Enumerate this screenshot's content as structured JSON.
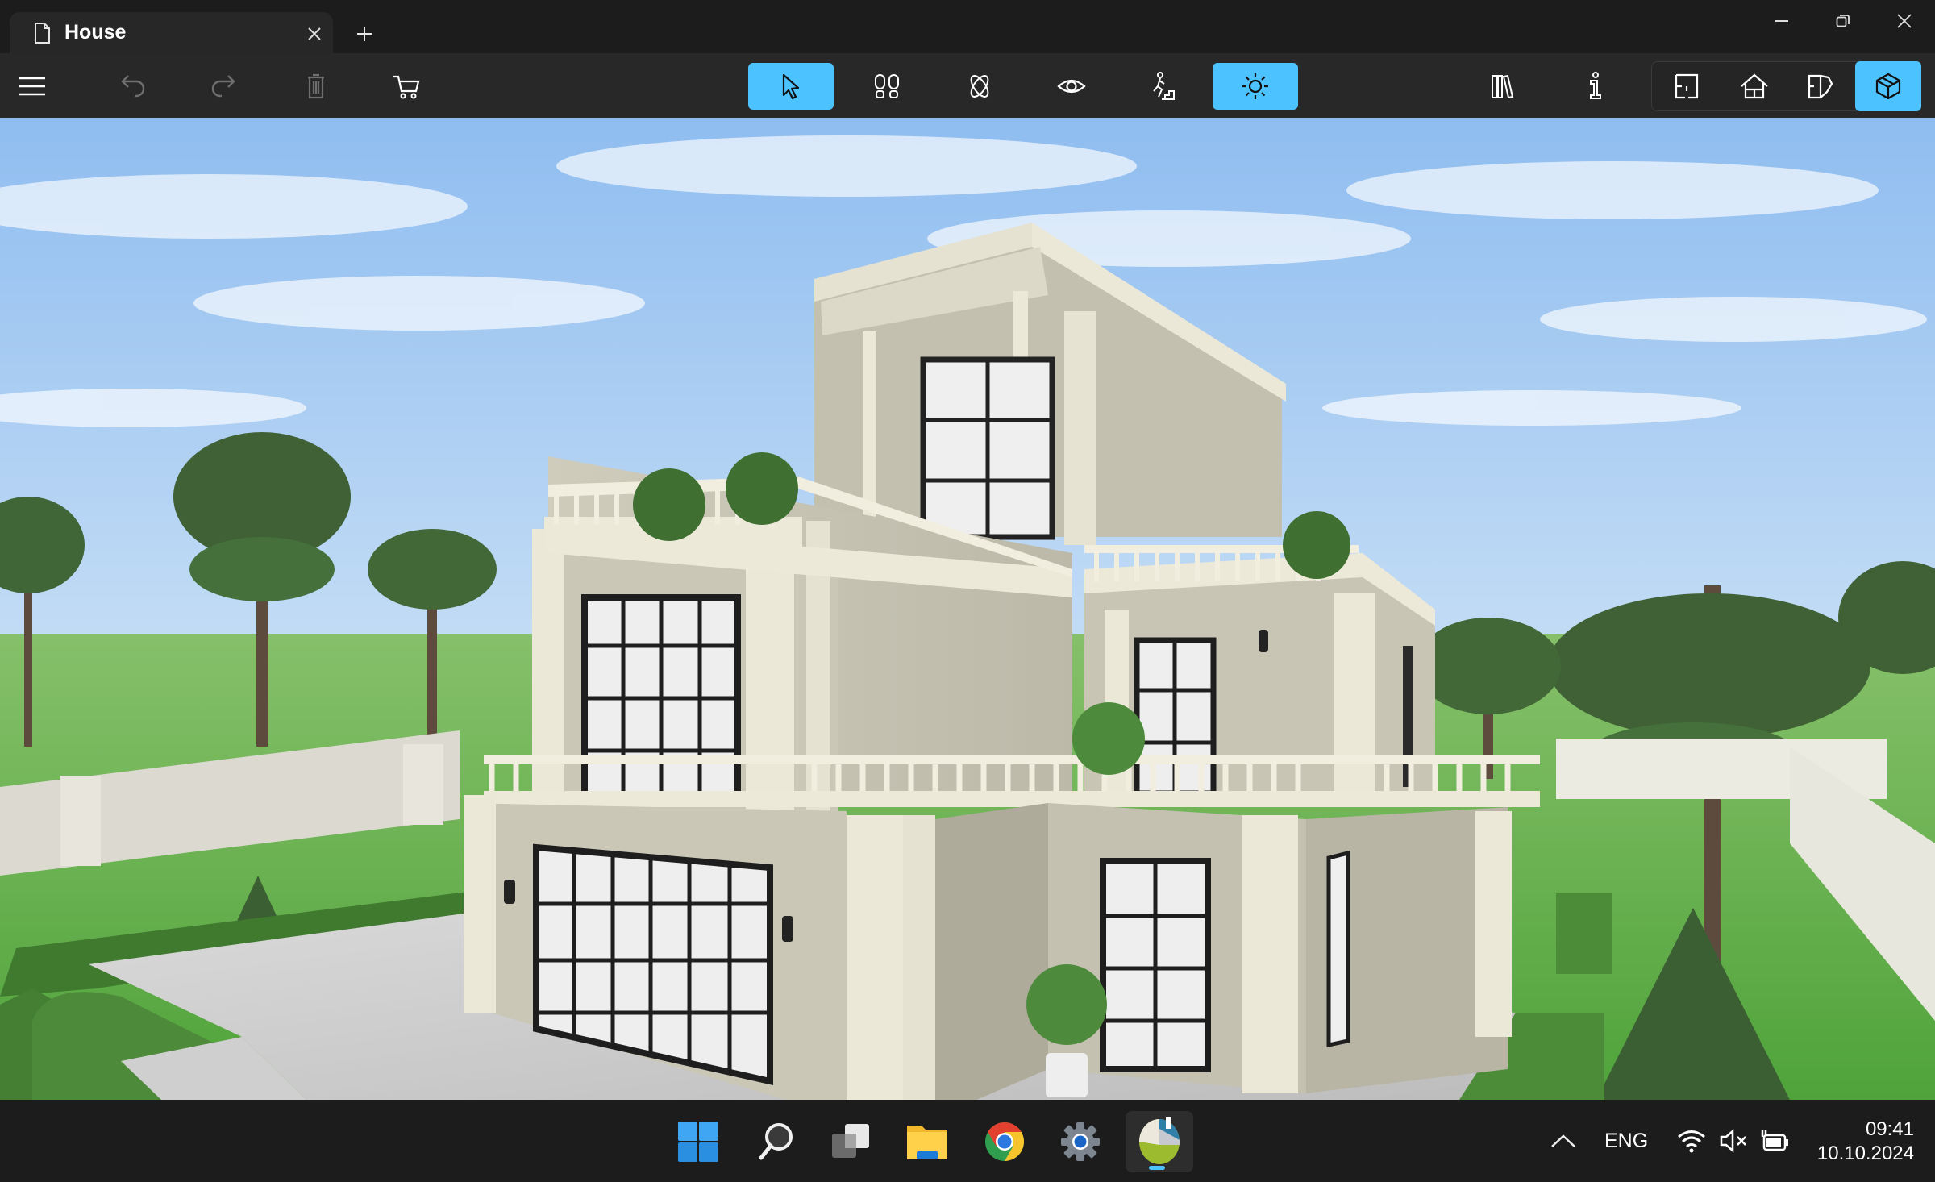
{
  "window": {
    "tab_title": "House",
    "tab_icon": "document-icon",
    "close_tab_icon": "close-icon",
    "new_tab_icon": "plus-icon",
    "controls": [
      "minimize-icon",
      "restore-icon",
      "close-icon"
    ]
  },
  "toolbar": {
    "left": [
      {
        "name": "menu",
        "icon": "hamburger-icon",
        "enabled": true
      },
      {
        "name": "undo",
        "icon": "undo-icon",
        "enabled": false
      },
      {
        "name": "redo",
        "icon": "redo-icon",
        "enabled": false
      },
      {
        "name": "delete",
        "icon": "trash-icon",
        "enabled": false
      },
      {
        "name": "shop",
        "icon": "cart-icon",
        "enabled": true
      }
    ],
    "center": [
      {
        "name": "select",
        "icon": "pointer-icon",
        "active": true
      },
      {
        "name": "walk",
        "icon": "footprints-icon",
        "active": false
      },
      {
        "name": "orbit",
        "icon": "orbit-icon",
        "active": false
      },
      {
        "name": "look",
        "icon": "eye-icon",
        "active": false
      },
      {
        "name": "climb",
        "icon": "stairs-walker-icon",
        "active": false
      },
      {
        "name": "lighting",
        "icon": "sun-icon",
        "active": true
      }
    ],
    "right": [
      {
        "name": "library",
        "icon": "books-icon"
      },
      {
        "name": "info",
        "icon": "info-icon"
      }
    ],
    "views": [
      {
        "name": "2d-plan",
        "icon": "floorplan-icon",
        "active": false
      },
      {
        "name": "elevation",
        "icon": "house-section-icon",
        "active": false
      },
      {
        "name": "split",
        "icon": "split-view-icon",
        "active": false
      },
      {
        "name": "3d",
        "icon": "cube-house-icon",
        "active": true
      }
    ],
    "accent_color": "#4cc2ff"
  },
  "viewport": {
    "scene": "3D render of a two-storey neoclassical house with balustrade terraces, paved patio, hedges, pine trees and white fence",
    "sky_color": "#9cc6f2",
    "grass_color": "#6fb84a",
    "wall_color": "#c9c6b6",
    "trim_color": "#ece9d8",
    "paving_color": "#cfcfcf"
  },
  "taskbar": {
    "apps": [
      {
        "name": "start",
        "icon": "windows-icon"
      },
      {
        "name": "search",
        "icon": "search-icon"
      },
      {
        "name": "task-view",
        "icon": "task-view-icon"
      },
      {
        "name": "file-explorer",
        "icon": "folder-icon"
      },
      {
        "name": "chrome",
        "icon": "chrome-icon"
      },
      {
        "name": "settings",
        "icon": "gear-icon"
      },
      {
        "name": "live-home-3d",
        "icon": "home-design-app-icon",
        "active": true
      }
    ],
    "tray": {
      "overflow_icon": "chevron-up-icon",
      "language": "ENG",
      "wifi_icon": "wifi-icon",
      "volume_icon": "volume-muted-icon",
      "battery_icon": "battery-charging-icon"
    },
    "time": "09:41",
    "date": "10.10.2024"
  }
}
